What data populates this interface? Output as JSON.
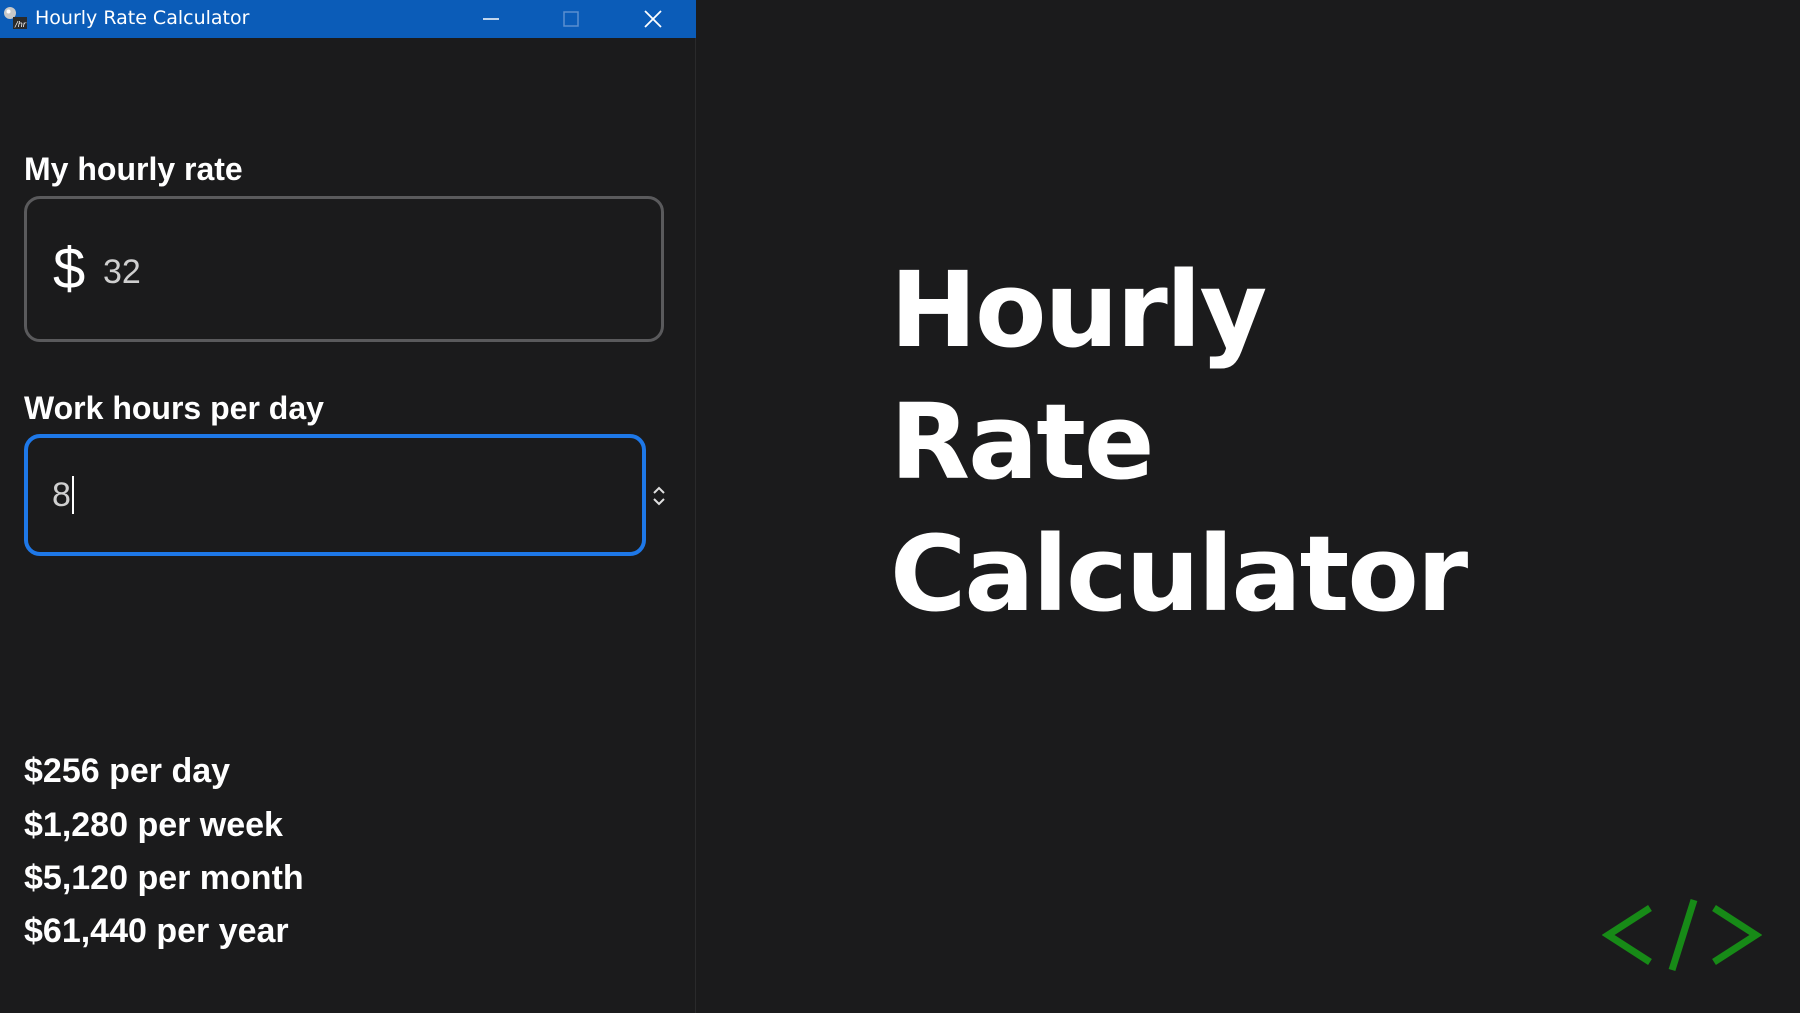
{
  "window": {
    "title": "Hourly Rate Calculator",
    "accent_color": "#0b5cb8",
    "buttons": [
      "minimize-icon",
      "maximize-icon",
      "close-icon"
    ]
  },
  "form": {
    "rate_label": "My hourly rate",
    "currency_symbol": "$",
    "rate_value": "32",
    "hours_label": "Work hours per day",
    "hours_value": "8",
    "focus_color": "#1e78e8"
  },
  "results": {
    "per_day": "$256 per day",
    "per_week": "$1,280 per week",
    "per_month": "$5,120 per month",
    "per_year": "$61,440 per year"
  },
  "hero": {
    "line1": "Hourly",
    "line2": "Rate",
    "line3": "Calculator"
  },
  "logo": {
    "icon": "code-brackets-icon",
    "color": "#178a17"
  }
}
